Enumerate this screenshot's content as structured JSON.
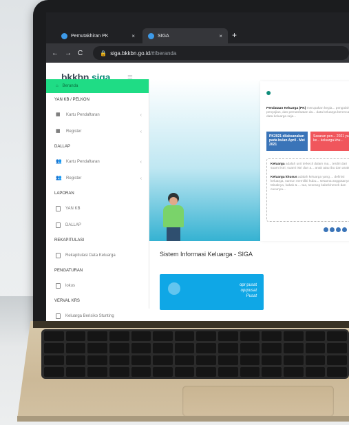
{
  "browser": {
    "tabs": [
      {
        "label": "Pemutakhiran PK",
        "close": "×"
      },
      {
        "label": "SIGA",
        "close": "×"
      }
    ],
    "new_tab": "+",
    "nav": {
      "back": "←",
      "forward": "→",
      "reload": "C"
    },
    "url_host": "siga.bkkbn.go.id",
    "url_path": "/#/beranda"
  },
  "app": {
    "logo_a": "bkkbn",
    "logo_b": "siga",
    "menu_icon": "≡"
  },
  "sidebar": {
    "active": "Beranda",
    "sections": [
      {
        "heading": "YAN KB / PELKON"
      },
      {
        "item": "Kartu Pendaftaran",
        "chev": "‹"
      },
      {
        "item": "Register",
        "chev": "‹"
      },
      {
        "heading": "DALLAP"
      },
      {
        "item": "Kartu Pendaftaran",
        "chev": "‹"
      },
      {
        "item": "Register",
        "chev": "‹"
      },
      {
        "heading": "LAPORAN"
      },
      {
        "item": "YAN KB"
      },
      {
        "item": "DALLAP"
      },
      {
        "heading": "REKAPITULASI"
      },
      {
        "item": "Rekapitulasi Data Keluarga"
      },
      {
        "heading": "PENGATURAN"
      },
      {
        "item": "lokus"
      },
      {
        "heading": "VERVAL KRS"
      },
      {
        "item": "Keluarga Berisiko Stunting"
      }
    ]
  },
  "hero": {
    "intro_bold": "Pendataan Keluarga (PK)",
    "intro_rest": " merupakan kegia... pengolahan, penyajian, dan pemanfaatan da... data keluarga berencana, data keluarga seja...",
    "pill1": "PK2021 dilaksanakan pada bulan April - Mei 2021",
    "pill2": "Sasaran pen... 2021 yaitu ke... keluarga khu...",
    "note1_bold": "Keluarga",
    "note1_rest": " adalah unit terkecil dalam ma... terdiri dari suami istri; suami istri dan a... anak atau ibu dan anak.",
    "note2_bold": "Keluarga khusus",
    "note2_rest": " adalah keluarga yang ... definisi keluarga, namun memiliki hubu... sesama anggotanya. Misalnya, kakak & ... tua, seorang kakek/nenek dan cucunya..."
  },
  "main": {
    "title": "Sistem Informasi Keluarga - SIGA",
    "user": {
      "name": "opr pusat",
      "username": "oprpusat",
      "level": "Pusat"
    }
  }
}
